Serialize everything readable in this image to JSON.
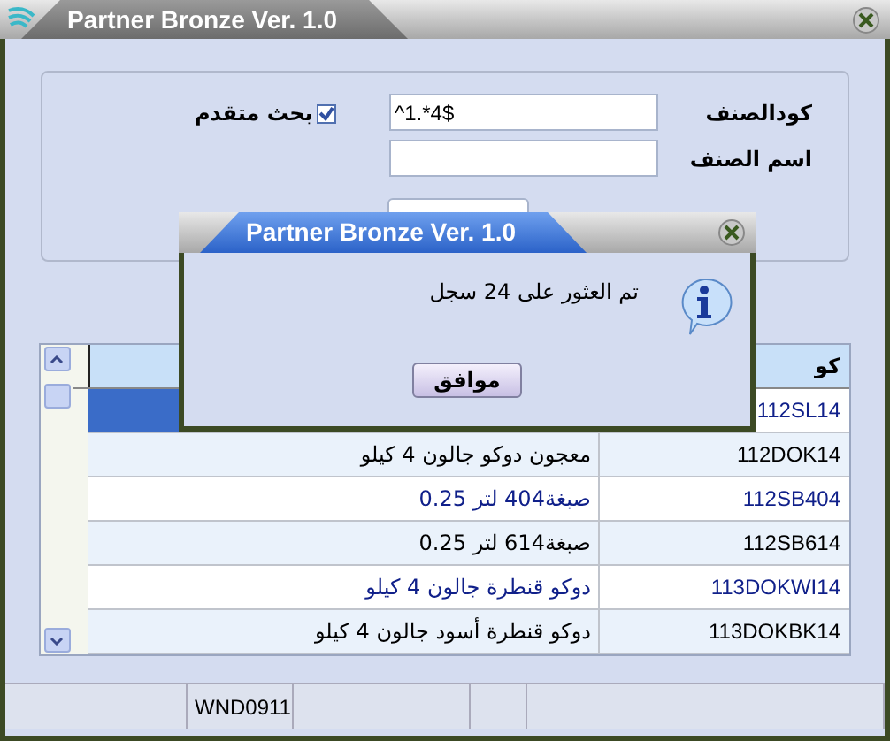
{
  "window": {
    "title": "Partner Bronze Ver. 1.0"
  },
  "search": {
    "code_label": "كودالصنف",
    "code_value": "^1.*4$",
    "name_label": "اسم الصنف",
    "advanced": {
      "label": "بحث متقدم",
      "checked": true
    }
  },
  "grid": {
    "columns": [
      {
        "label": "كو"
      }
    ],
    "rows": [
      {
        "code": "112SL14",
        "selected": true
      },
      {
        "code": "112DOK14",
        "name": "معجون دوكو جالون 4 كيلو",
        "selected": false
      },
      {
        "code": "112SB404",
        "name": "صبغة404 لتر 0.25",
        "selected": false
      },
      {
        "code": "112SB614",
        "name": "صبغة614 لتر 0.25",
        "selected": false
      },
      {
        "code": "113DOKWI14",
        "name": "دوكو قنطرة جالون 4 كيلو",
        "selected": false
      },
      {
        "code": "113DOKBK14",
        "name": "دوكو قنطرة أسود جالون 4 كيلو",
        "selected": false
      }
    ]
  },
  "status_bar": {
    "workstation": "WND0911"
  },
  "dialog": {
    "title": "Partner Bronze Ver. 1.0",
    "message": "تم العثور على 24 سجل",
    "button": "موافق"
  }
}
